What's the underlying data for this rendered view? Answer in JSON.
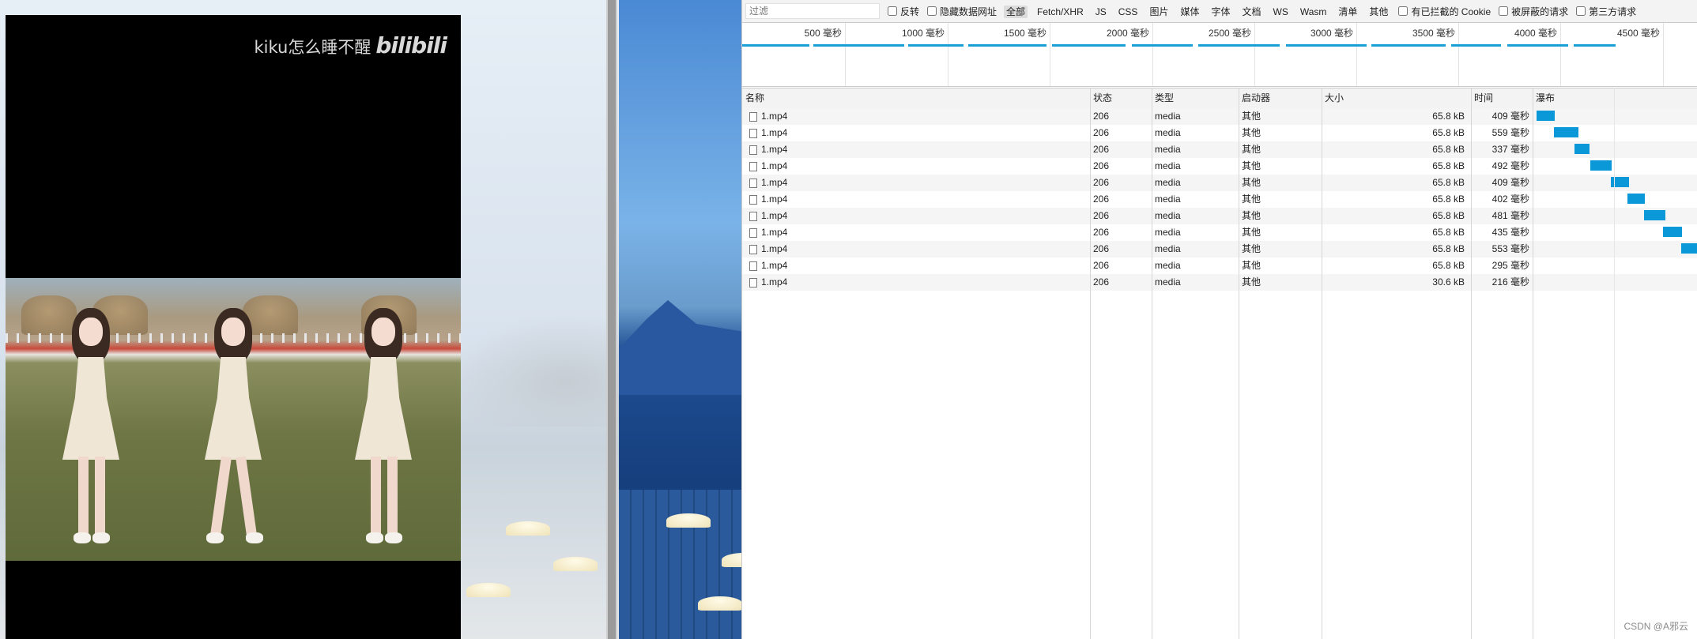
{
  "video": {
    "watermark_text": "kiku怎么睡不醒",
    "watermark_logo": "bilibili"
  },
  "devtools": {
    "filter_placeholder": "过滤",
    "checkboxes": {
      "invert": "反转",
      "hide_data_urls": "隐藏数据网址",
      "blocked_cookies": "有已拦截的 Cookie",
      "blocked_requests": "被屏蔽的请求",
      "third_party": "第三方请求"
    },
    "type_filters": [
      "全部",
      "Fetch/XHR",
      "JS",
      "CSS",
      "图片",
      "媒体",
      "字体",
      "文档",
      "WS",
      "Wasm",
      "清单",
      "其他"
    ],
    "active_type_filter": "全部",
    "overview_ticks": [
      "500 毫秒",
      "1000 毫秒",
      "1500 毫秒",
      "2000 毫秒",
      "2500 毫秒",
      "3000 毫秒",
      "3500 毫秒",
      "4000 毫秒",
      "4500 毫秒"
    ],
    "columns": [
      "名称",
      "状态",
      "类型",
      "启动器",
      "大小",
      "时间",
      "瀑布"
    ],
    "rows": [
      {
        "name": "1.mp4",
        "status": "206",
        "type": "media",
        "initiator": "其他",
        "size": "65.8 kB",
        "time": "409 毫秒"
      },
      {
        "name": "1.mp4",
        "status": "206",
        "type": "media",
        "initiator": "其他",
        "size": "65.8 kB",
        "time": "559 毫秒"
      },
      {
        "name": "1.mp4",
        "status": "206",
        "type": "media",
        "initiator": "其他",
        "size": "65.8 kB",
        "time": "337 毫秒"
      },
      {
        "name": "1.mp4",
        "status": "206",
        "type": "media",
        "initiator": "其他",
        "size": "65.8 kB",
        "time": "492 毫秒"
      },
      {
        "name": "1.mp4",
        "status": "206",
        "type": "media",
        "initiator": "其他",
        "size": "65.8 kB",
        "time": "409 毫秒"
      },
      {
        "name": "1.mp4",
        "status": "206",
        "type": "media",
        "initiator": "其他",
        "size": "65.8 kB",
        "time": "402 毫秒"
      },
      {
        "name": "1.mp4",
        "status": "206",
        "type": "media",
        "initiator": "其他",
        "size": "65.8 kB",
        "time": "481 毫秒"
      },
      {
        "name": "1.mp4",
        "status": "206",
        "type": "media",
        "initiator": "其他",
        "size": "65.8 kB",
        "time": "435 毫秒"
      },
      {
        "name": "1.mp4",
        "status": "206",
        "type": "media",
        "initiator": "其他",
        "size": "65.8 kB",
        "time": "553 毫秒"
      },
      {
        "name": "1.mp4",
        "status": "206",
        "type": "media",
        "initiator": "其他",
        "size": "65.8 kB",
        "time": "295 毫秒"
      },
      {
        "name": "1.mp4",
        "status": "206",
        "type": "media",
        "initiator": "其他",
        "size": "30.6 kB",
        "time": "216 毫秒"
      }
    ],
    "accent_color": "#0a98d8"
  },
  "credit": "CSDN @A邪云"
}
